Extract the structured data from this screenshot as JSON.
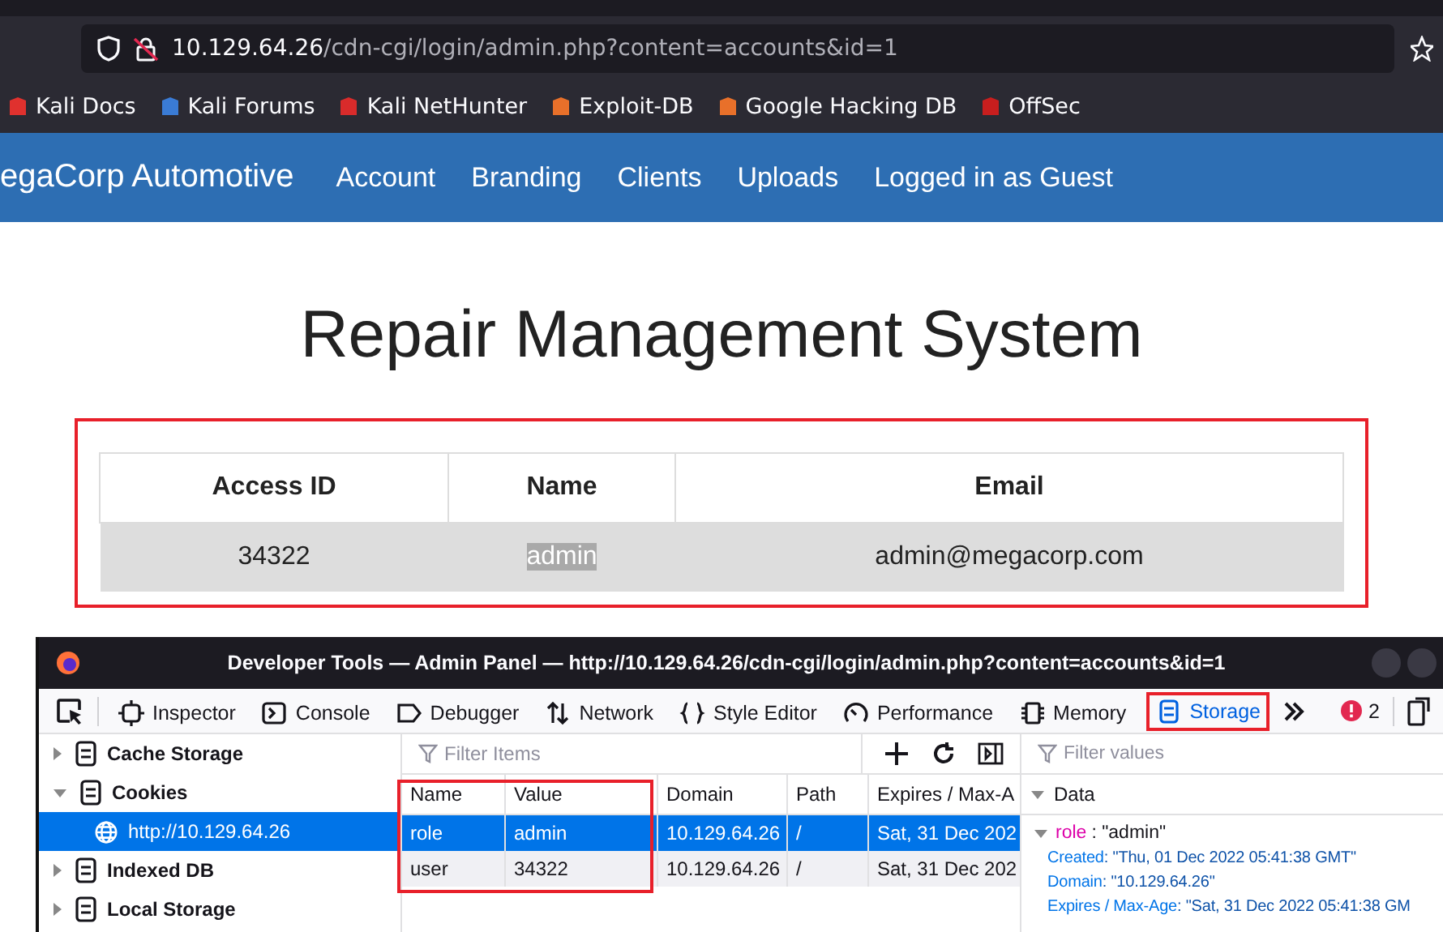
{
  "browser": {
    "url_host": "10.129.64.26",
    "url_path": "/cdn-cgi/login/admin.php?content=accounts&id=1",
    "bookmarks": [
      {
        "label": "Kali Docs",
        "color": "#e0312e"
      },
      {
        "label": "Kali Forums",
        "color": "#3a7bd5"
      },
      {
        "label": "Kali NetHunter",
        "color": "#d92b2b"
      },
      {
        "label": "Exploit-DB",
        "color": "#e8702a"
      },
      {
        "label": "Google Hacking DB",
        "color": "#e8702a"
      },
      {
        "label": "OffSec",
        "color": "#c81e1e"
      }
    ]
  },
  "site": {
    "brand": "egaCorp Automotive",
    "nav": [
      "Account",
      "Branding",
      "Clients",
      "Uploads",
      "Logged in as Guest"
    ],
    "heading": "Repair Management System",
    "table": {
      "highlighted": true,
      "columns": [
        "Access ID",
        "Name",
        "Email"
      ],
      "rows": [
        {
          "cells": [
            "34322",
            "admin",
            "admin@megacorp.com"
          ],
          "text_selected": [
            false,
            true,
            false
          ]
        }
      ]
    }
  },
  "devtools": {
    "title": "Developer Tools — Admin Panel — http://10.129.64.26/cdn-cgi/login/admin.php?content=accounts&id=1",
    "tools": [
      {
        "label": "Inspector",
        "selected": false,
        "highlighted": false
      },
      {
        "label": "Console",
        "selected": false,
        "highlighted": false
      },
      {
        "label": "Debugger",
        "selected": false,
        "highlighted": false
      },
      {
        "label": "Network",
        "selected": false,
        "highlighted": false
      },
      {
        "label": "Style Editor",
        "selected": false,
        "highlighted": false
      },
      {
        "label": "Performance",
        "selected": false,
        "highlighted": false
      },
      {
        "label": "Memory",
        "selected": false,
        "highlighted": false
      },
      {
        "label": "Storage",
        "selected": true,
        "highlighted": true
      }
    ],
    "error_count": "2",
    "sidebar": [
      {
        "label": "Cache Storage",
        "expanded": false
      },
      {
        "label": "Cookies",
        "expanded": true,
        "children": [
          {
            "label": "http://10.129.64.26",
            "selected": true
          }
        ]
      },
      {
        "label": "Indexed DB",
        "expanded": false
      },
      {
        "label": "Local Storage",
        "expanded": false
      }
    ],
    "filter_placeholder": "Filter Items",
    "cookies": {
      "columns": [
        "Name",
        "Value",
        "Domain",
        "Path",
        "Expires / Max-A"
      ],
      "first_columns_highlighted": true,
      "rows": [
        {
          "cells": [
            "role",
            "admin",
            "10.129.64.26",
            "/",
            "Sat, 31 Dec 202"
          ],
          "selected": true
        },
        {
          "cells": [
            "user",
            "34322",
            "10.129.64.26",
            "/",
            "Sat, 31 Dec 202"
          ],
          "selected": false
        }
      ]
    },
    "values_placeholder": "Filter values",
    "data": {
      "section": "Data",
      "expanded": true,
      "key": "role",
      "value": ": \"admin\"",
      "key_expanded": true,
      "fields": [
        {
          "name": "Created",
          "value": ": \"Thu, 01 Dec 2022 05:41:38 GMT\""
        },
        {
          "name": "Domain",
          "value": ": \"10.129.64.26\""
        },
        {
          "name": "Expires / Max-Age",
          "value": ": \"Sat, 31 Dec 2022 05:41:38 GM"
        }
      ]
    }
  }
}
